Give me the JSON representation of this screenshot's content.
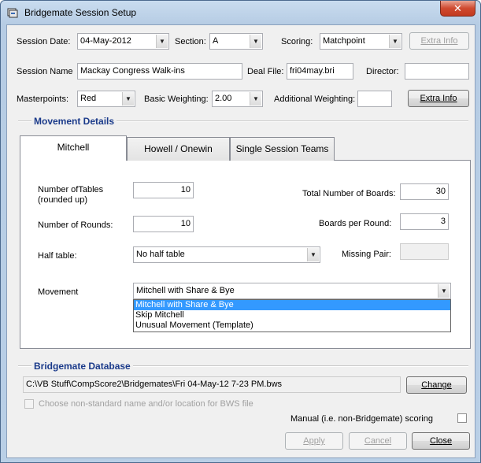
{
  "window": {
    "title": "Bridgemate Session Setup",
    "close_glyph": "✕"
  },
  "session": {
    "date_label": "Session Date:",
    "date_value": "04-May-2012",
    "section_label": "Section:",
    "section_value": "A",
    "scoring_label": "Scoring:",
    "scoring_value": "Matchpoint",
    "extra_info_top": "Extra Info",
    "name_label": "Session Name",
    "name_value": "Mackay Congress Walk-ins",
    "deal_file_label": "Deal File:",
    "deal_file_value": "fri04may.bri",
    "director_label": "Director:",
    "director_value": "",
    "masterpoints_label": "Masterpoints:",
    "masterpoints_value": "Red",
    "basic_weighting_label": "Basic Weighting:",
    "basic_weighting_value": "2.00",
    "additional_weighting_label": "Additional Weighting:",
    "additional_weighting_value": "",
    "extra_info_bottom": "Extra Info"
  },
  "movement": {
    "group_title": "Movement Details",
    "tabs": [
      "Mitchell",
      "Howell / Onewin",
      "Single Session Teams"
    ],
    "tables_label_1": "Number ofTables",
    "tables_label_2": "(rounded up)",
    "tables_value": "10",
    "rounds_label": "Number of Rounds:",
    "rounds_value": "10",
    "half_table_label": "Half table:",
    "half_table_value": "No half table",
    "total_boards_label": "Total Number of Boards:",
    "total_boards_value": "30",
    "boards_per_round_label": "Boards per Round:",
    "boards_per_round_value": "3",
    "missing_pair_label": "Missing Pair:",
    "missing_pair_value": "",
    "movement_label": "Movement",
    "movement_value": "Mitchell with Share & Bye",
    "options": [
      "Mitchell with Share & Bye",
      "Skip Mitchell",
      "Unusual Movement (Template)"
    ]
  },
  "database": {
    "group_title": "Bridgemate Database",
    "path": "C:\\VB Stuff\\CompScore2\\Bridgemates\\Fri 04-May-12 7-23 PM.bws",
    "change_label": "Change",
    "nonstandard_label": "Choose non-standard name and/or location for BWS file",
    "manual_scoring_label": "Manual (i.e. non-Bridgemate) scoring"
  },
  "footer": {
    "apply": "Apply",
    "cancel": "Cancel",
    "close": "Close"
  }
}
